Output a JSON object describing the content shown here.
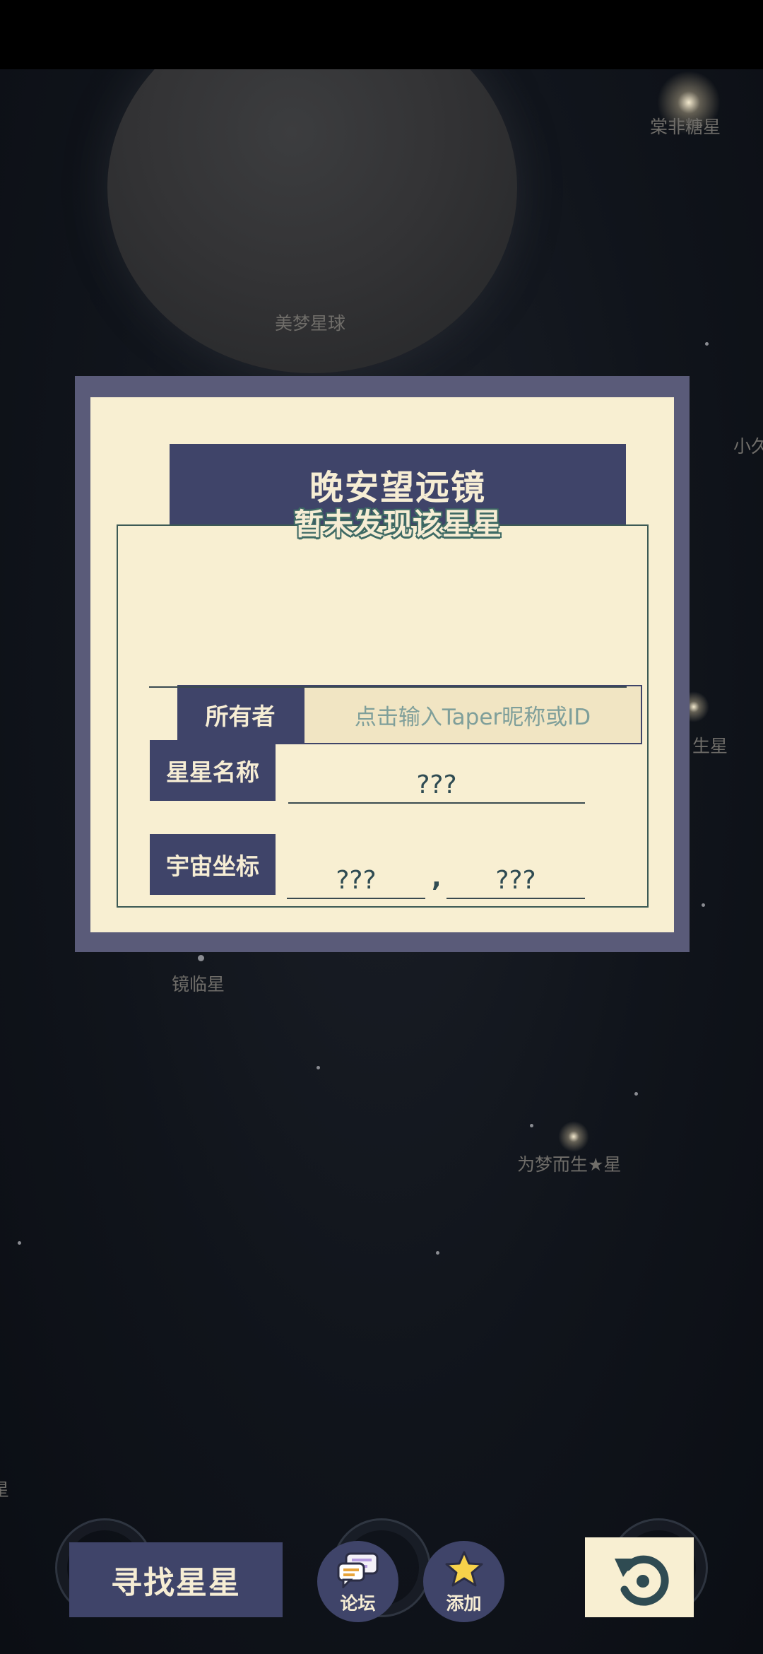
{
  "sky": {
    "star_labels": [
      "棠非糖星",
      "美梦星球",
      "小久",
      "生星",
      "镜临星",
      "为梦而生★星",
      "星"
    ]
  },
  "dialog": {
    "title": "晚安望远镜",
    "status": "暂未发现该星星",
    "owner_label": "所有者",
    "owner_placeholder": "点击输入Taper昵称或ID",
    "star_name_label": "星星名称",
    "star_name_value": "???",
    "coords_label": "宇宙坐标",
    "coord_x": "???",
    "coord_separator": ",",
    "coord_y": "???"
  },
  "bottom": {
    "find_label": "寻找星星",
    "forum_label": "论坛",
    "add_label": "添加"
  },
  "colors": {
    "navy": "#3f4469",
    "cream": "#f8efd2",
    "frame": "#5a5b79",
    "teal_text": "#2f4b52"
  }
}
